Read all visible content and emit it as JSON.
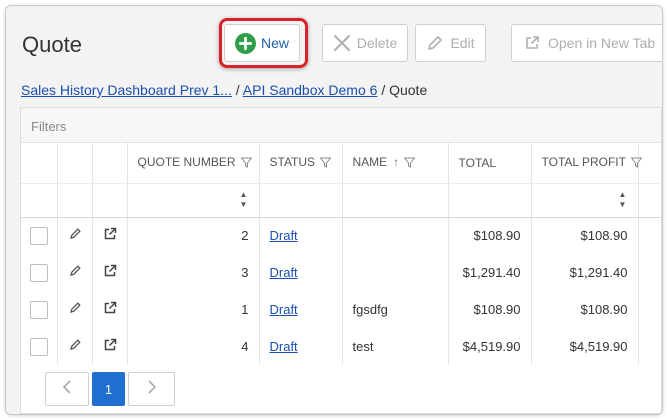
{
  "page": {
    "title": "Quote"
  },
  "toolbar": {
    "new_label": "New",
    "delete_label": "Delete",
    "edit_label": "Edit",
    "open_new_tab_label": "Open in New Tab"
  },
  "breadcrumb": {
    "crumb1": "Sales History Dashboard Prev 1...",
    "sep1": "/",
    "crumb2": "API Sandbox Demo 6",
    "sep2": "/",
    "current": "Quote"
  },
  "filters": {
    "label": "Filters"
  },
  "table": {
    "headers": {
      "quote_number": "QUOTE NUMBER",
      "status": "STATUS",
      "name": "NAME",
      "total": "TOTAL",
      "total_profit": "TOTAL PROFIT"
    },
    "name_sort": "ascending",
    "rows": [
      {
        "quote_number": "2",
        "status": "Draft",
        "name": "",
        "total": "$108.90",
        "total_profit": "$108.90"
      },
      {
        "quote_number": "3",
        "status": "Draft",
        "name": "",
        "total": "$1,291.40",
        "total_profit": "$1,291.40"
      },
      {
        "quote_number": "1",
        "status": "Draft",
        "name": "fgsdfg",
        "total": "$108.90",
        "total_profit": "$108.90"
      },
      {
        "quote_number": "4",
        "status": "Draft",
        "name": "test",
        "total": "$4,519.90",
        "total_profit": "$4,519.90"
      }
    ]
  },
  "pagination": {
    "current_page": "1",
    "prev_icon": "chevron-left-icon",
    "next_icon": "chevron-right-icon"
  },
  "colors": {
    "accent": "#1f6fd1",
    "link": "#1a4fb0",
    "new_icon": "#2e9e4a",
    "highlight": "#d82228"
  }
}
